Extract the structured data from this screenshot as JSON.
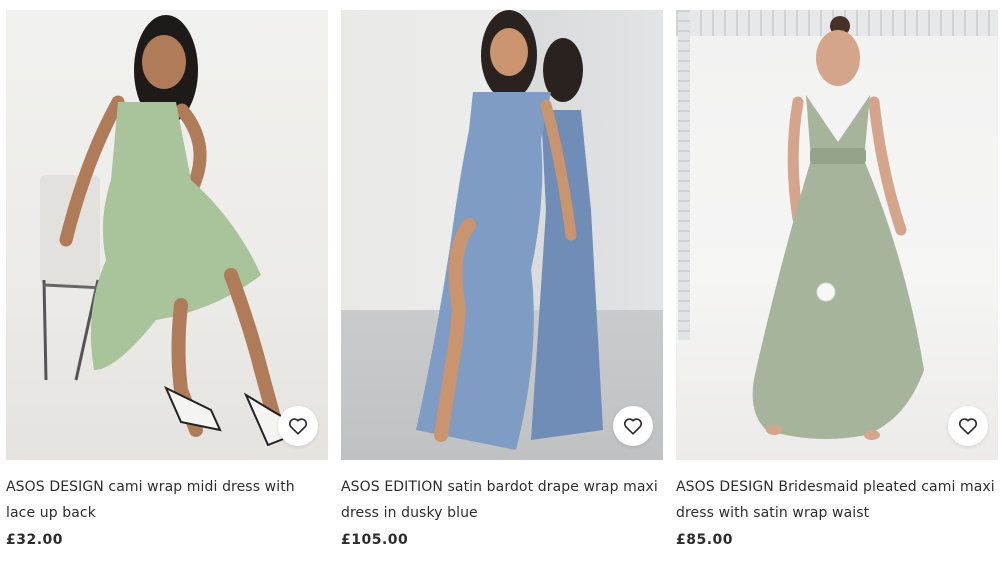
{
  "products": [
    {
      "title": "ASOS DESIGN cami wrap midi dress with lace up back",
      "price": "£32.00",
      "dress_color": "#a9c39a",
      "wishlist_icon": "heart-outline-icon"
    },
    {
      "title": "ASOS EDITION satin bardot drape wrap maxi dress in dusky blue",
      "price": "£105.00",
      "dress_color": "#7f9dc4",
      "wishlist_icon": "heart-outline-icon"
    },
    {
      "title": "ASOS DESIGN Bridesmaid pleated cami maxi dress with satin wrap waist",
      "price": "£85.00",
      "dress_color": "#a7b49c",
      "wishlist_icon": "heart-outline-icon"
    }
  ]
}
